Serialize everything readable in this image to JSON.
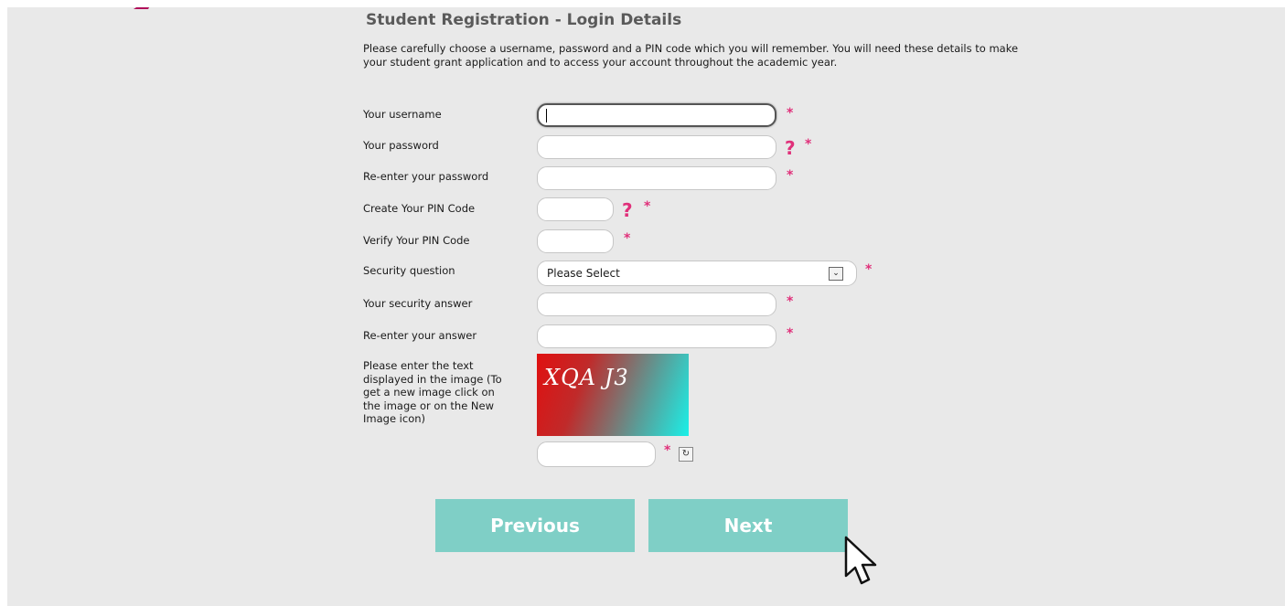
{
  "page": {
    "title": "Student Registration - Login Details",
    "intro": "Please carefully choose a username, password and a PIN code which you will remember. You will need these details to make your student grant application and to access your account throughout the academic year."
  },
  "form": {
    "username_label": "Your username",
    "password_label": "Your password",
    "reenter_password_label": "Re-enter your password",
    "create_pin_label": "Create Your PIN Code",
    "verify_pin_label": "Verify Your PIN Code",
    "security_question_label": "Security question",
    "security_question_value": "Please Select",
    "security_answer_label": "Your security answer",
    "reenter_answer_label": "Re-enter your answer",
    "captcha_label": "Please enter the text displayed in the image (To get a new image click on the image or on the New Image icon)",
    "captcha_text": "XQA J3",
    "required_marker": "*",
    "help_marker": "?"
  },
  "buttons": {
    "previous": "Previous",
    "next": "Next"
  },
  "colors": {
    "button": "#7fcfc6",
    "required": "#e0307a",
    "panel": "#e9e9e9"
  },
  "icons": {
    "refresh": "new-image-icon",
    "dropdown": "chevron-down-icon",
    "cursor": "mouse-pointer-icon"
  }
}
